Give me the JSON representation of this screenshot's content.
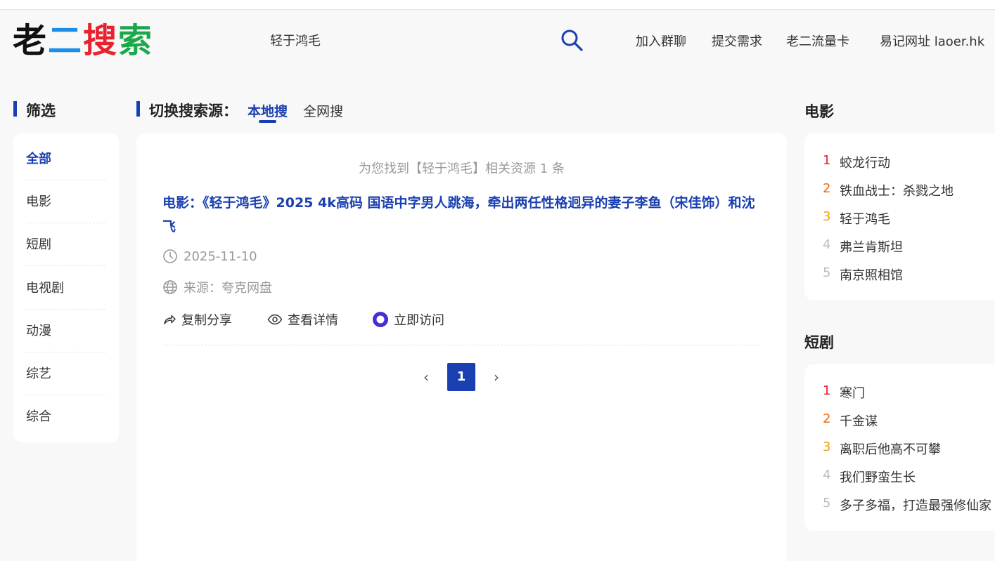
{
  "brand": {
    "logo_chars": [
      {
        "text": "老",
        "color": "#111111"
      },
      {
        "text": "二",
        "color": "#1c8ee8"
      },
      {
        "text": "搜",
        "color": "#e8222e"
      },
      {
        "text": "索",
        "color": "#1aa84b"
      }
    ],
    "accent": "#1a3fb0"
  },
  "search": {
    "query": "轻于鸿毛",
    "button_icon": "search-icon"
  },
  "nav": [
    {
      "label": "加入群聊"
    },
    {
      "label": "提交需求"
    },
    {
      "label": "老二流量卡"
    },
    {
      "label": "易记网址 laoer.hk"
    }
  ],
  "filter": {
    "title": "筛选",
    "items": [
      {
        "label": "全部"
      },
      {
        "label": "电影"
      },
      {
        "label": "短剧"
      },
      {
        "label": "电视剧"
      },
      {
        "label": "动漫"
      },
      {
        "label": "综艺"
      },
      {
        "label": "综合"
      }
    ],
    "active_index": 0
  },
  "source_switch": {
    "title": "切换搜索源：",
    "tabs": [
      {
        "label": "本地搜"
      },
      {
        "label": "全网搜"
      }
    ],
    "active_index": 0
  },
  "results": {
    "summary": "为您找到【轻于鸿毛】相关资源 1 条",
    "items": [
      {
        "title": "电影：《轻于鸿毛》2025 4k高码 国语中字男人跳海，牵出两任性格迥异的妻子李鱼（宋佳饰）和沈飞",
        "date": "2025-11-10",
        "source": "来源：夸克网盘",
        "actions": {
          "share": "复制分享",
          "detail": "查看详情",
          "visit": "立即访问"
        }
      }
    ]
  },
  "pagination": {
    "prev": "‹",
    "current": "1",
    "next": "›"
  },
  "side_lists": [
    {
      "title": "电影",
      "items": [
        {
          "rank": "1",
          "text": "蛟龙行动",
          "color": "#e8222e"
        },
        {
          "rank": "2",
          "text": "铁血战士：杀戮之地",
          "color": "#f06a0c"
        },
        {
          "rank": "3",
          "text": "轻于鸿毛",
          "color": "#f0a10c"
        },
        {
          "rank": "4",
          "text": "弗兰肯斯坦",
          "color": "#bbbbbb"
        },
        {
          "rank": "5",
          "text": "南京照相馆",
          "color": "#bbbbbb"
        }
      ]
    },
    {
      "title": "短剧",
      "items": [
        {
          "rank": "1",
          "text": "寒门",
          "color": "#e8222e"
        },
        {
          "rank": "2",
          "text": "千金谋",
          "color": "#f06a0c"
        },
        {
          "rank": "3",
          "text": "离职后他高不可攀",
          "color": "#f0a10c"
        },
        {
          "rank": "4",
          "text": "我们野蛮生长",
          "color": "#bbbbbb"
        },
        {
          "rank": "5",
          "text": "多子多福，打造最强修仙家",
          "color": "#bbbbbb"
        }
      ]
    }
  ]
}
